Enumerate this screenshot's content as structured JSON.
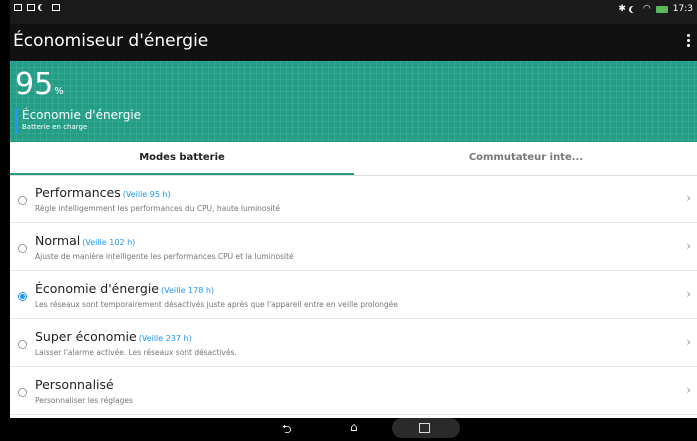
{
  "status_bar": {
    "time": "17:3",
    "left_icons": [
      "notification-icon",
      "screen-icon",
      "moon-icon",
      "bag-icon"
    ],
    "right_icons": [
      "bluetooth-icon",
      "moon-icon",
      "wifi-icon",
      "battery-charging-icon"
    ]
  },
  "action_bar": {
    "title": "Économiseur d'énergie",
    "menu_icon": "overflow-menu-icon"
  },
  "hero": {
    "battery_percent": "95",
    "percent_sign": "%",
    "mode_label": "Économie d'énergie",
    "status": "Batterie en charge",
    "accent_color": "#229e87"
  },
  "tabs": [
    {
      "label": "Modes batterie",
      "active": true
    },
    {
      "label": "Commutateur inte...",
      "active": false
    }
  ],
  "modes": [
    {
      "title": "Performances",
      "standby": "(Veille 95 h)",
      "desc": "Règle intelligemment les performances du CPU, haute luminosité",
      "selected": false
    },
    {
      "title": "Normal",
      "standby": "(Veille 102 h)",
      "desc": "Ajuste de manière intelligente les performances CPU et la luminosité",
      "selected": false
    },
    {
      "title": "Économie d'énergie",
      "standby": "(Veille 178 h)",
      "desc": "Les réseaux sont temporairement désactivés juste après que l'appareil entre en veille prolongée",
      "selected": true
    },
    {
      "title": "Super économie",
      "standby": "(Veille 237 h)",
      "desc": "Laisser l'alarme activée. Les réseaux sont désactivés.",
      "selected": false
    },
    {
      "title": "Personnalisé",
      "standby": "",
      "desc": "Personnaliser les réglages",
      "selected": false
    }
  ],
  "chevron": "›",
  "nav": {
    "back_glyph": "⮌",
    "home_glyph": "⌂"
  }
}
